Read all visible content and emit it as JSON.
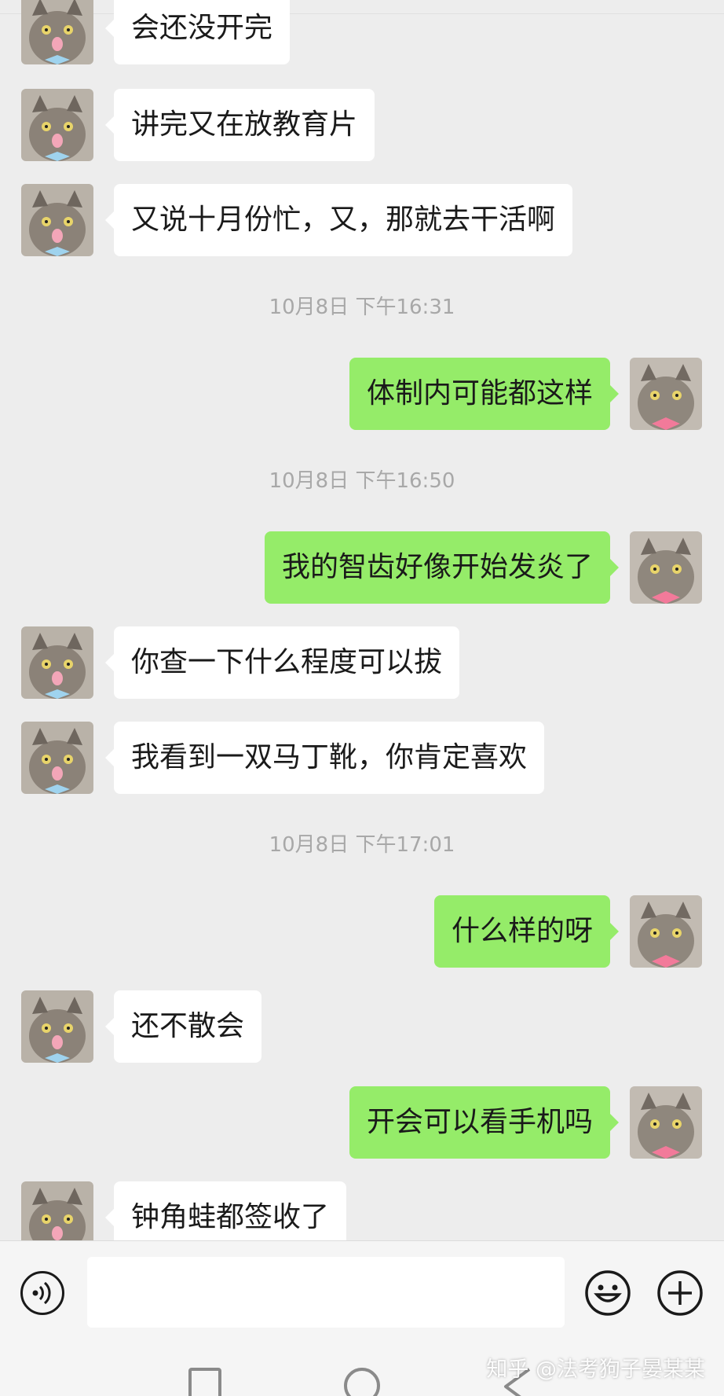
{
  "messages": [
    {
      "side": "recv",
      "text": "会还没开完"
    },
    {
      "side": "recv",
      "text": "讲完又在放教育片"
    },
    {
      "side": "recv",
      "text": "又说十月份忙，又，那就去干活啊"
    },
    {
      "timestamp": "10月8日 下午16:31"
    },
    {
      "side": "sent",
      "text": "体制内可能都这样"
    },
    {
      "timestamp": "10月8日 下午16:50"
    },
    {
      "side": "sent",
      "text": "我的智齿好像开始发炎了"
    },
    {
      "side": "recv",
      "text": "你查一下什么程度可以拔"
    },
    {
      "side": "recv",
      "text": "我看到一双马丁靴，你肯定喜欢"
    },
    {
      "timestamp": "10月8日 下午17:01"
    },
    {
      "side": "sent",
      "text": "什么样的呀"
    },
    {
      "side": "recv",
      "text": "还不散会"
    },
    {
      "side": "sent",
      "text": "开会可以看手机吗"
    },
    {
      "side": "recv",
      "text": "钟角蛙都签收了"
    }
  ],
  "input": {
    "value": ""
  },
  "icons": {
    "voice": "voice-icon",
    "emoji": "emoji-icon",
    "plus": "plus-icon",
    "back": "nav-back-icon",
    "home": "nav-home-icon",
    "recent": "nav-recent-icon"
  },
  "colors": {
    "sent_bubble": "#95ec69",
    "recv_bubble": "#ffffff",
    "background": "#ededed",
    "timestamp": "#a8a8a8"
  },
  "watermark": "知乎 @法考狗子晏某某"
}
